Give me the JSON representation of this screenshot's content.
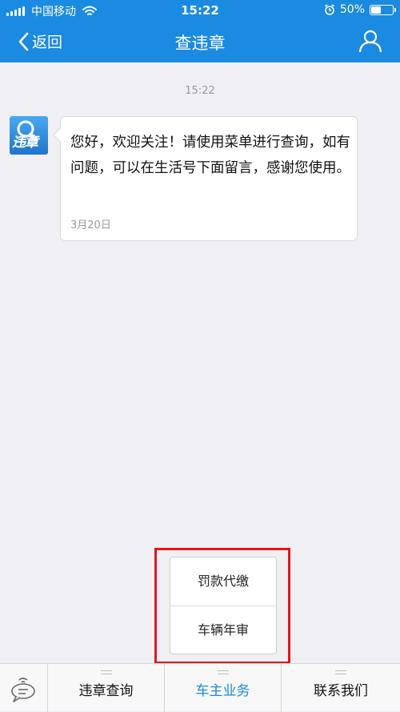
{
  "status_bar": {
    "carrier": "中国移动",
    "time": "15:22",
    "battery": "50%",
    "battery_level": 0.5
  },
  "nav": {
    "back_label": "返回",
    "title": "查违章"
  },
  "chat": {
    "time_label": "15:22",
    "avatar_text": "违章",
    "message": "您好，欢迎关注！请使用菜单进行查询，如有问题，可以在生活号下面留言，感谢您使用。",
    "message_date": "3月20日"
  },
  "submenu": {
    "items": [
      "罚款代缴",
      "车辆年审"
    ]
  },
  "menu": {
    "tabs": [
      {
        "label": "违章查询"
      },
      {
        "label": "车主业务"
      },
      {
        "label": "联系我们"
      }
    ]
  },
  "colors": {
    "brand": "#1b8ae1",
    "highlight": "#e5141b"
  },
  "icons": {
    "back": "chevron-left-icon",
    "user": "user-icon",
    "wifi": "wifi-icon",
    "alarm": "alarm-icon",
    "keyboard_toggle": "chat-bubble-icon"
  }
}
